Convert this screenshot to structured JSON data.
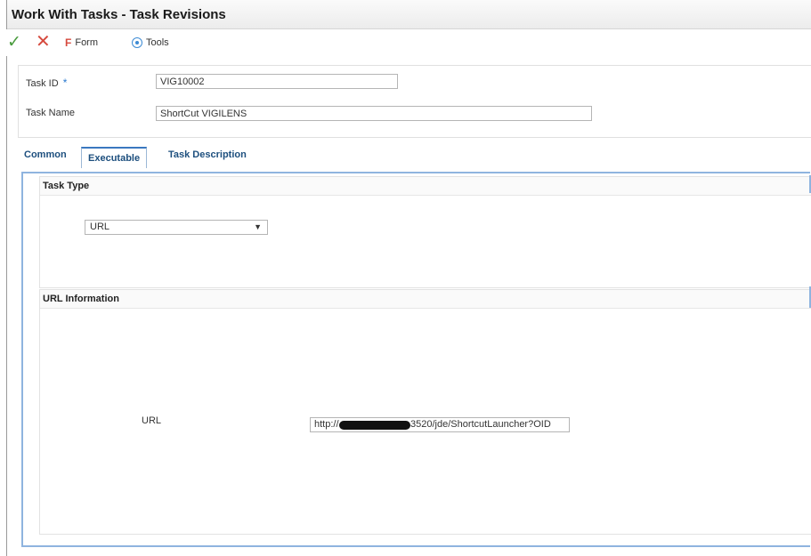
{
  "window": {
    "title": "Work With Tasks - Task Revisions"
  },
  "toolbar": {
    "ok_icon": "checkmark-icon",
    "cancel_icon": "x-icon",
    "form_label": "Form",
    "tools_label": "Tools"
  },
  "header": {
    "task_id_label": "Task ID",
    "task_id_required": "*",
    "task_id_value": "VIG10002",
    "task_name_label": "Task Name",
    "task_name_value": "ShortCut VIGILENS"
  },
  "tabs": [
    {
      "label": "Common"
    },
    {
      "label": "Executable",
      "active": true
    },
    {
      "label": "Task Description"
    }
  ],
  "task_type": {
    "heading": "Task Type",
    "selected": "URL",
    "caret": "▼"
  },
  "url_information": {
    "heading": "URL Information",
    "url_label": "URL",
    "url_prefix": "http://",
    "url_suffix": "3520/jde/ShortcutLauncher?OID"
  },
  "colors": {
    "accent_blue": "#3a78c0",
    "tab_text": "#1d4f7e",
    "ok_green": "#4a9c3e",
    "cancel_red": "#d64a3e"
  }
}
